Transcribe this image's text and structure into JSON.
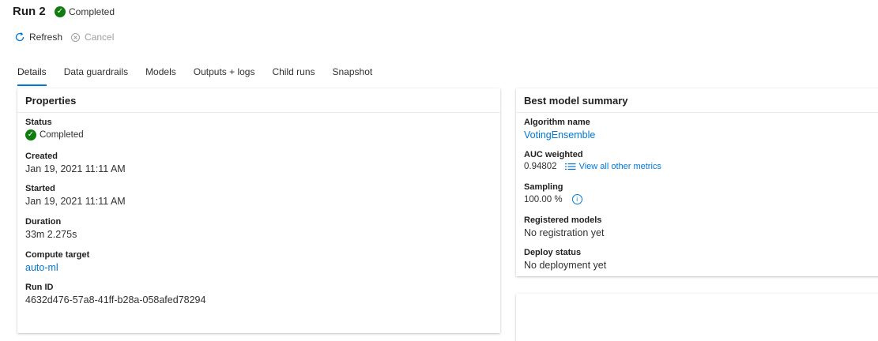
{
  "header": {
    "title": "Run 2",
    "status": "Completed"
  },
  "toolbar": {
    "refresh_label": "Refresh",
    "cancel_label": "Cancel"
  },
  "tabs": [
    {
      "label": "Details",
      "active": true
    },
    {
      "label": "Data guardrails",
      "active": false
    },
    {
      "label": "Models",
      "active": false
    },
    {
      "label": "Outputs + logs",
      "active": false
    },
    {
      "label": "Child runs",
      "active": false
    },
    {
      "label": "Snapshot",
      "active": false
    }
  ],
  "properties": {
    "title": "Properties",
    "status_label": "Status",
    "status_value": "Completed",
    "created_label": "Created",
    "created_value": "Jan 19, 2021 11:11 AM",
    "started_label": "Started",
    "started_value": "Jan 19, 2021 11:11 AM",
    "duration_label": "Duration",
    "duration_value": "33m 2.275s",
    "compute_label": "Compute target",
    "compute_value": "auto-ml",
    "runid_label": "Run ID",
    "runid_value": "4632d476-57a8-41ff-b28a-058afed78294"
  },
  "best_model": {
    "title": "Best model summary",
    "algorithm_label": "Algorithm name",
    "algorithm_value": "VotingEnsemble",
    "auc_label": "AUC weighted",
    "auc_value": "0.94802",
    "metrics_link": "View all other metrics",
    "sampling_label": "Sampling",
    "sampling_value": "100.00 %",
    "registered_label": "Registered models",
    "registered_value": "No registration yet",
    "deploy_label": "Deploy status",
    "deploy_value": "No deployment yet"
  },
  "colors": {
    "accent": "#0078d4",
    "success": "#107c10",
    "text": "#323130",
    "muted": "#a19f9d"
  }
}
